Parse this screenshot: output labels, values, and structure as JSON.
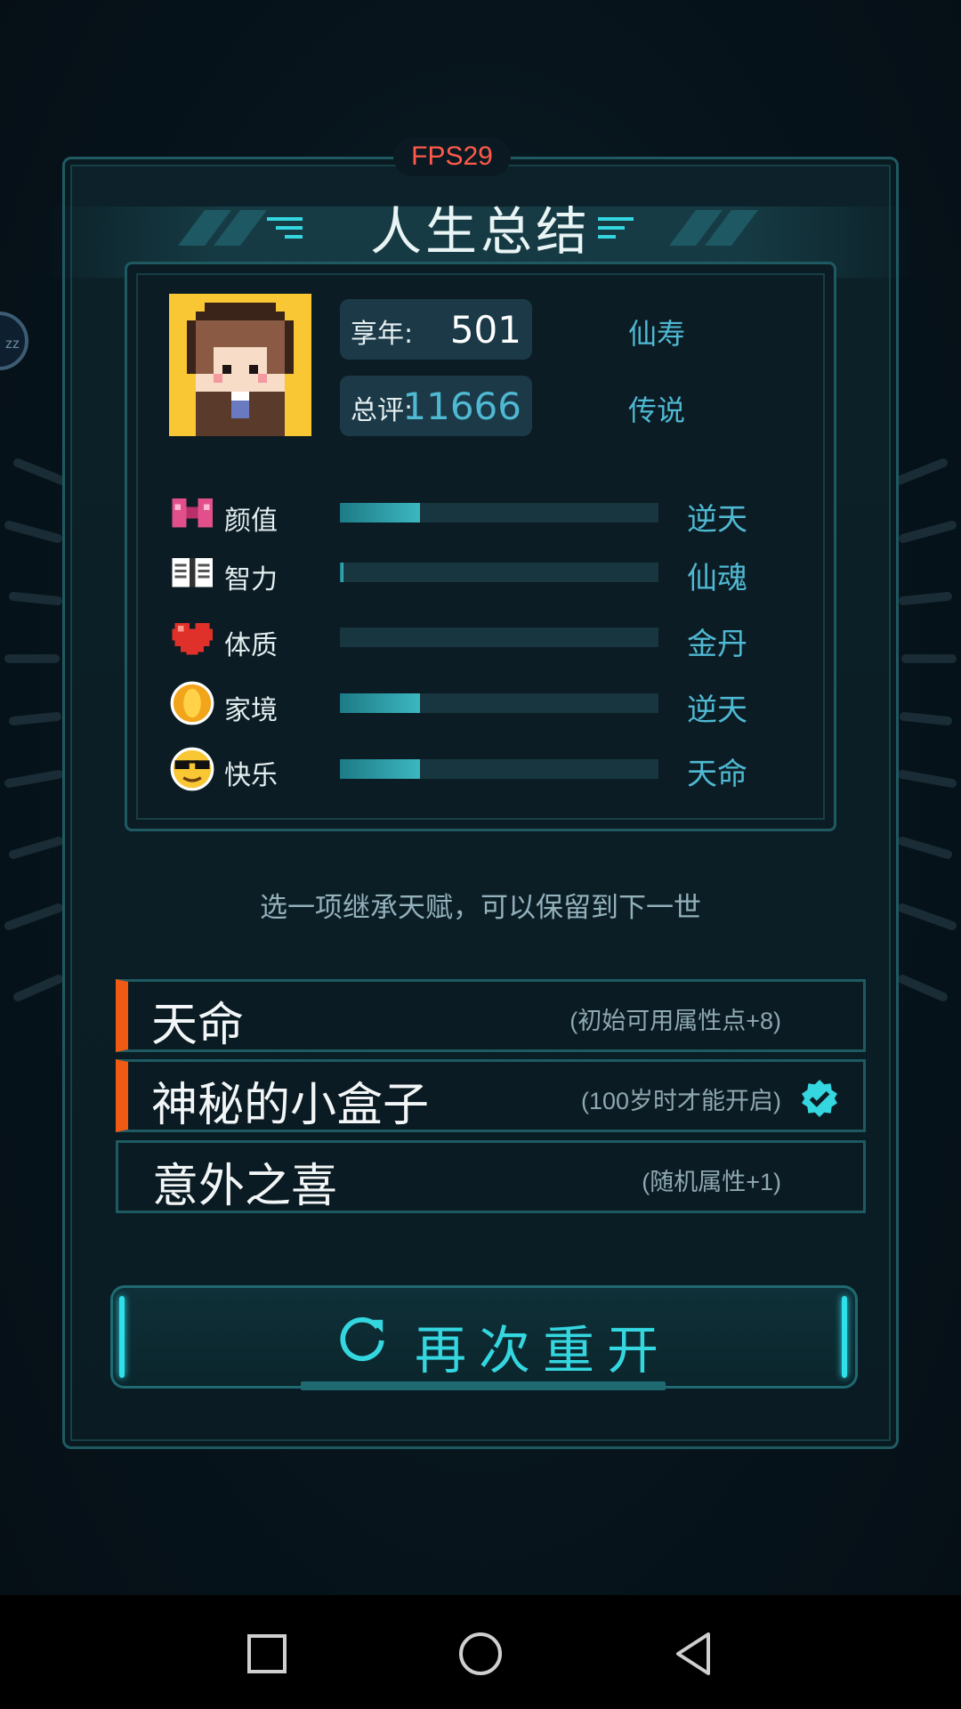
{
  "fps_text": "FPS29",
  "bubble_text": "zz",
  "title": "人生总结",
  "summary": {
    "age_label": "享年:",
    "age_value": "501",
    "age_grade": "仙寿",
    "score_label": "总评:",
    "score_value": "11666",
    "score_grade": "传说"
  },
  "stats": [
    {
      "icon": "bow-icon",
      "name": "颜值",
      "fill": 0.25,
      "grade": "逆天"
    },
    {
      "icon": "book-icon",
      "name": "智力",
      "fill": 0.01,
      "grade": "仙魂"
    },
    {
      "icon": "heart-icon",
      "name": "体质",
      "fill": 0.0,
      "grade": "金丹"
    },
    {
      "icon": "coin-icon",
      "name": "家境",
      "fill": 0.25,
      "grade": "逆天"
    },
    {
      "icon": "sunglasses-face-icon",
      "name": "快乐",
      "fill": 0.25,
      "grade": "天命"
    }
  ],
  "prompt": "选一项继承天赋，可以保留到下一世",
  "talents": [
    {
      "name": "天命",
      "desc": "(初始可用属性点+8)",
      "selected": true,
      "checked": false
    },
    {
      "name": "神秘的小盒子",
      "desc": "(100岁时才能开启)",
      "selected": true,
      "checked": true
    },
    {
      "name": "意外之喜",
      "desc": "(随机属性+1)",
      "selected": false,
      "checked": false
    }
  ],
  "restart_label": "再次重开",
  "colors": {
    "accent_cyan": "#34d6e0",
    "grade_blue": "#4fb8d2",
    "selected_orange": "#f15a13",
    "fps_red": "#ff5a4a"
  },
  "nav": [
    "square-icon",
    "circle-icon",
    "triangle-back-icon"
  ]
}
